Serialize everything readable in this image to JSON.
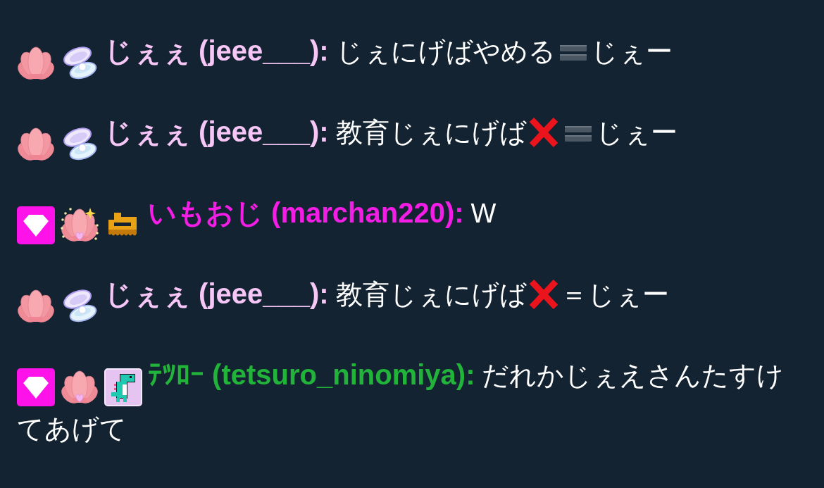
{
  "messages": [
    {
      "badges": [
        {
          "kind": "shell"
        },
        {
          "kind": "open-clam"
        }
      ],
      "author": "じぇぇ (jeee___):",
      "color": "#f5c6f6",
      "parts": [
        {
          "kind": "text",
          "text": "じぇにげばやめる"
        },
        {
          "kind": "equals"
        },
        {
          "kind": "text",
          "text": "じぇー"
        }
      ]
    },
    {
      "badges": [
        {
          "kind": "shell"
        },
        {
          "kind": "open-clam"
        }
      ],
      "author": "じぇぇ (jeee___):",
      "color": "#f5c6f6",
      "parts": [
        {
          "kind": "text",
          "text": "教育じぇにげば"
        },
        {
          "kind": "cross"
        },
        {
          "kind": "equals"
        },
        {
          "kind": "text",
          "text": "じぇー"
        }
      ]
    },
    {
      "badges": [
        {
          "kind": "gem"
        },
        {
          "kind": "shell-heart-sparkle"
        },
        {
          "kind": "train"
        }
      ],
      "author": "いもおじ (marchan220):",
      "color": "#f31de6",
      "parts": [
        {
          "kind": "text",
          "text": "W"
        }
      ]
    },
    {
      "badges": [
        {
          "kind": "shell"
        },
        {
          "kind": "open-clam"
        }
      ],
      "author": "じぇぇ (jeee___):",
      "color": "#f5c6f6",
      "parts": [
        {
          "kind": "text",
          "text": "教育じぇにげば"
        },
        {
          "kind": "cross"
        },
        {
          "kind": "text",
          "text": "＝じぇー"
        }
      ]
    },
    {
      "badges": [
        {
          "kind": "gem"
        },
        {
          "kind": "shell-heart"
        },
        {
          "kind": "dino"
        }
      ],
      "author": "ﾃﾂﾛｰ (tetsuro_ninomiya):",
      "color": "#22b33a",
      "parts": [
        {
          "kind": "text",
          "text": "だれかじぇえさんたすけ"
        },
        {
          "kind": "text",
          "text": "てあげて"
        }
      ]
    }
  ]
}
